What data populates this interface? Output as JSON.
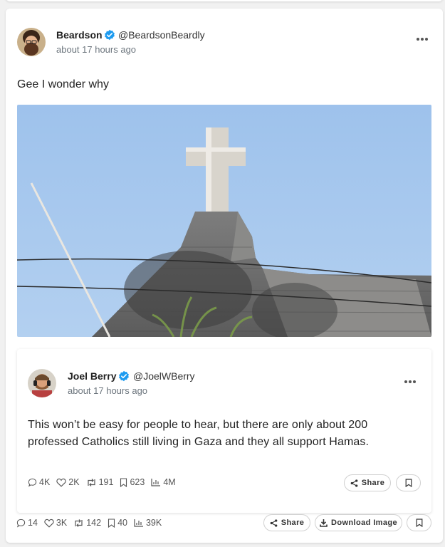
{
  "post": {
    "author_name": "Beardson",
    "author_handle": "@BeardsonBeardly",
    "time": "about 17 hours ago",
    "text": "Gee I wonder why",
    "stats": {
      "replies": "14",
      "likes": "3K",
      "reposts": "142",
      "bookmarks": "40",
      "views": "39K"
    },
    "share_label": "Share",
    "download_label": "Download Image"
  },
  "quote": {
    "author_name": "Joel Berry",
    "author_handle": "@JoelWBerry",
    "time": "about 17 hours ago",
    "text": "This won’t be easy for people to hear, but there are only about 200 professed Catholics still living in Gaza and they all support Hamas.",
    "stats": {
      "replies": "4K",
      "likes": "2K",
      "reposts": "191",
      "bookmarks": "623",
      "views": "4M"
    },
    "share_label": "Share"
  },
  "icons": {
    "verified": "verified-badge-icon",
    "more": "more-horizontal-icon",
    "reply": "comment-icon",
    "like": "heart-icon",
    "repost": "repost-icon",
    "bookmark": "bookmark-icon",
    "views": "bar-chart-icon",
    "share": "share-icon",
    "download": "download-icon"
  },
  "colors": {
    "verified_blue": "#1d9bf0",
    "sky": "#a9c9ee",
    "background": "#f1f1f1"
  }
}
